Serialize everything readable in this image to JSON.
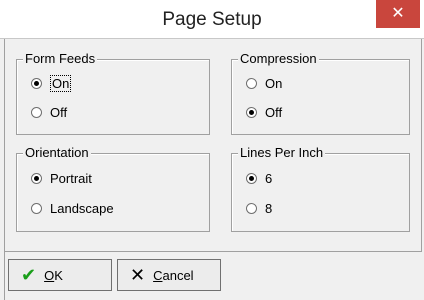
{
  "dialog": {
    "title": "Page Setup",
    "close_symbol": "✕"
  },
  "groups": {
    "form_feeds": {
      "label": "Form Feeds",
      "options": [
        "On",
        "Off"
      ],
      "selected": "On"
    },
    "compression": {
      "label": "Compression",
      "options": [
        "On",
        "Off"
      ],
      "selected": "Off"
    },
    "orientation": {
      "label": "Orientation",
      "options": [
        "Portrait",
        "Landscape"
      ],
      "selected": "Portrait"
    },
    "lines_per_inch": {
      "label": "Lines Per Inch",
      "options": [
        "6",
        "8"
      ],
      "selected": "6"
    }
  },
  "buttons": {
    "ok": {
      "accel": "O",
      "rest": "K",
      "icon": "check-icon"
    },
    "cancel": {
      "accel": "C",
      "rest": "ancel",
      "icon": "x-icon"
    }
  }
}
